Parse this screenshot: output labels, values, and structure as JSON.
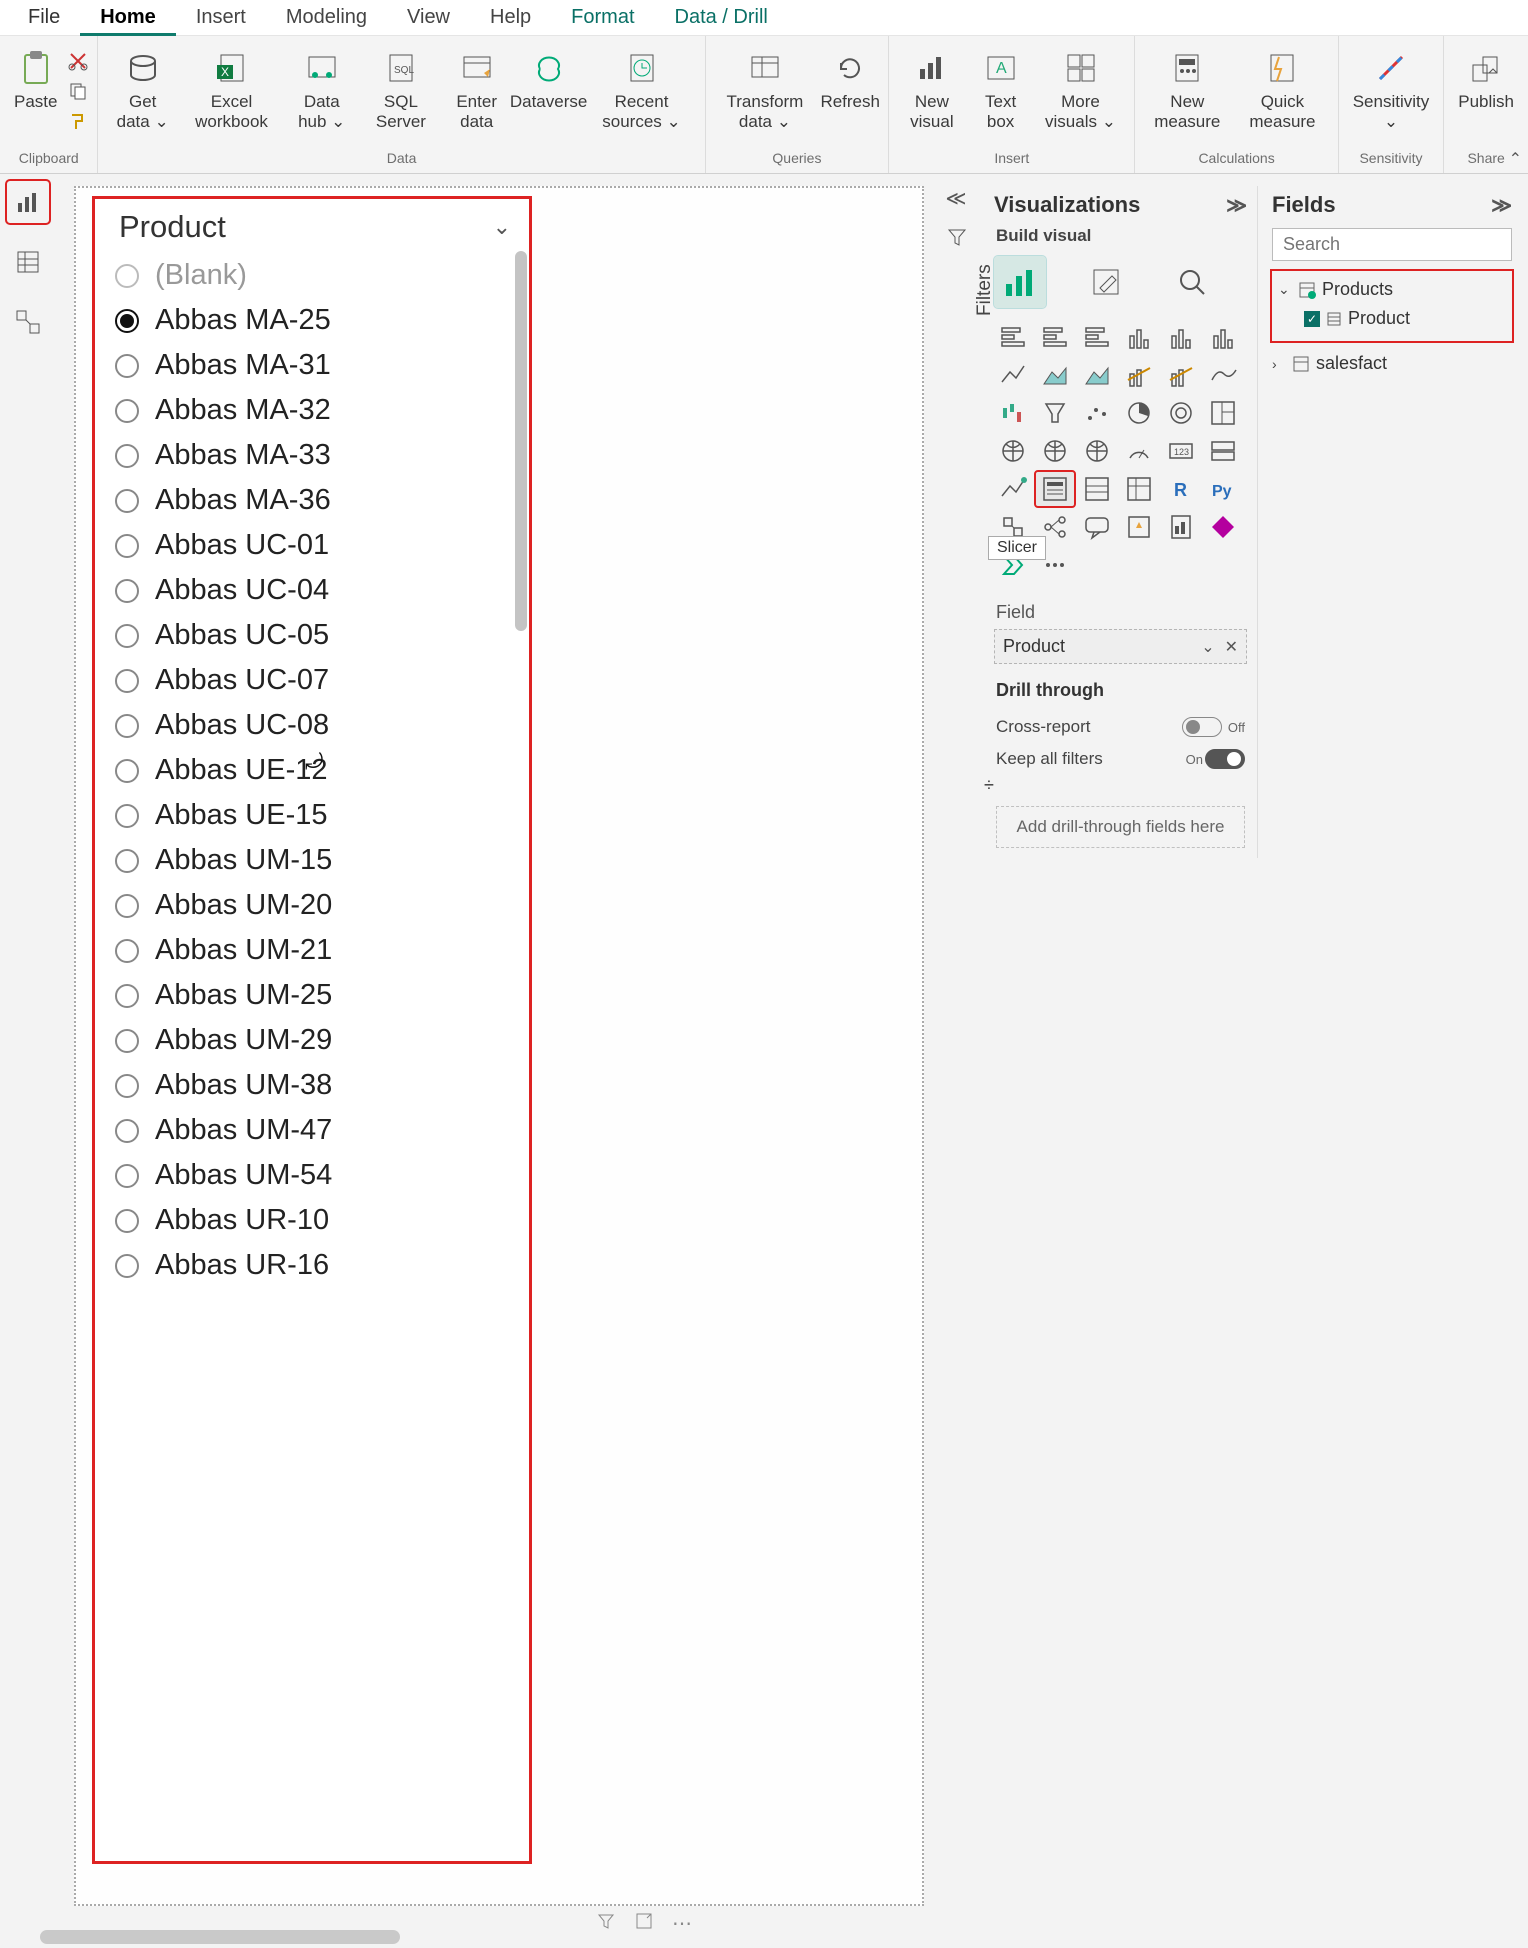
{
  "ribbon": {
    "tabs": [
      "File",
      "Home",
      "Insert",
      "Modeling",
      "View",
      "Help",
      "Format",
      "Data / Drill"
    ],
    "active_tab": "Home",
    "groups": {
      "clipboard": {
        "label": "Clipboard",
        "paste": "Paste"
      },
      "data": {
        "label": "Data",
        "get_data": "Get data ⌄",
        "excel": "Excel workbook",
        "data_hub": "Data hub ⌄",
        "sql": "SQL Server",
        "enter": "Enter data",
        "dataverse": "Dataverse",
        "recent": "Recent sources ⌄"
      },
      "queries": {
        "label": "Queries",
        "transform": "Transform data ⌄",
        "refresh": "Refresh"
      },
      "insert": {
        "label": "Insert",
        "new_visual": "New visual",
        "text_box": "Text box",
        "more_visuals": "More visuals ⌄"
      },
      "calc": {
        "label": "Calculations",
        "new_measure": "New measure",
        "quick_measure": "Quick measure"
      },
      "sensitivity": {
        "label": "Sensitivity",
        "btn": "Sensitivity ⌄"
      },
      "share": {
        "label": "Share",
        "publish": "Publish"
      }
    }
  },
  "slicer": {
    "title": "Product",
    "selected": "Abbas MA-25",
    "options": [
      "(Blank)",
      "Abbas MA-25",
      "Abbas MA-31",
      "Abbas MA-32",
      "Abbas MA-33",
      "Abbas MA-36",
      "Abbas UC-01",
      "Abbas UC-04",
      "Abbas UC-05",
      "Abbas UC-07",
      "Abbas UC-08",
      "Abbas UE-12",
      "Abbas UE-15",
      "Abbas UM-15",
      "Abbas UM-20",
      "Abbas UM-21",
      "Abbas UM-25",
      "Abbas UM-29",
      "Abbas UM-38",
      "Abbas UM-47",
      "Abbas UM-54",
      "Abbas UR-10",
      "Abbas UR-16"
    ]
  },
  "filters_pane": {
    "title": "Filters"
  },
  "visualizations": {
    "title": "Visualizations",
    "subtitle": "Build visual",
    "field_label": "Field",
    "field_value": "Product",
    "tooltip": "Slicer",
    "drill_title": "Drill through",
    "cross_report": "Cross-report",
    "cross_report_state": "Off",
    "keep_filters": "Keep all filters",
    "keep_filters_state": "On",
    "drill_placeholder": "Add drill-through fields here"
  },
  "fields": {
    "title": "Fields",
    "search_placeholder": "Search",
    "table1": "Products",
    "column1": "Product",
    "table2": "salesfact"
  }
}
